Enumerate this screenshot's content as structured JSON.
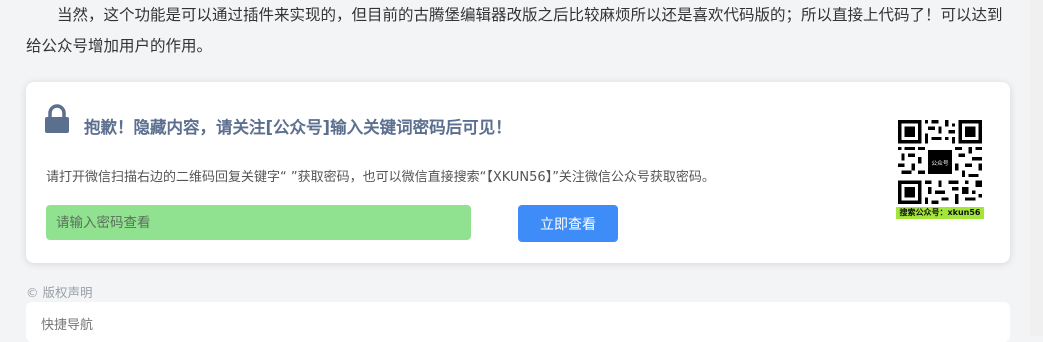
{
  "article": {
    "paragraph": "当然，这个功能是可以通过插件来实现的，但目前的古腾堡编辑器改版之后比较麻烦所以还是喜欢代码版的；所以直接上代码了！可以达到给公众号增加用户的作用。"
  },
  "hidden_content": {
    "lock_icon": "lock-icon",
    "title": "抱歉！隐藏内容，请关注[公众号]输入关键词密码后可见！",
    "description": "请打开微信扫描右边的二维码回复关键字“ ”获取密码，也可以微信直接搜索“【XKUN56】”关注微信公众号获取密码。",
    "input_placeholder": "请输入密码查看",
    "input_value": "",
    "button_label": "立即查看",
    "qr_caption": "搜索公众号：xkun56",
    "qr_center_text": "公众号",
    "accent_color": "#3d8cf7",
    "input_color": "#90e291"
  },
  "footer": {
    "copyright": "© 版权声明",
    "quick_nav": "快捷导航"
  }
}
